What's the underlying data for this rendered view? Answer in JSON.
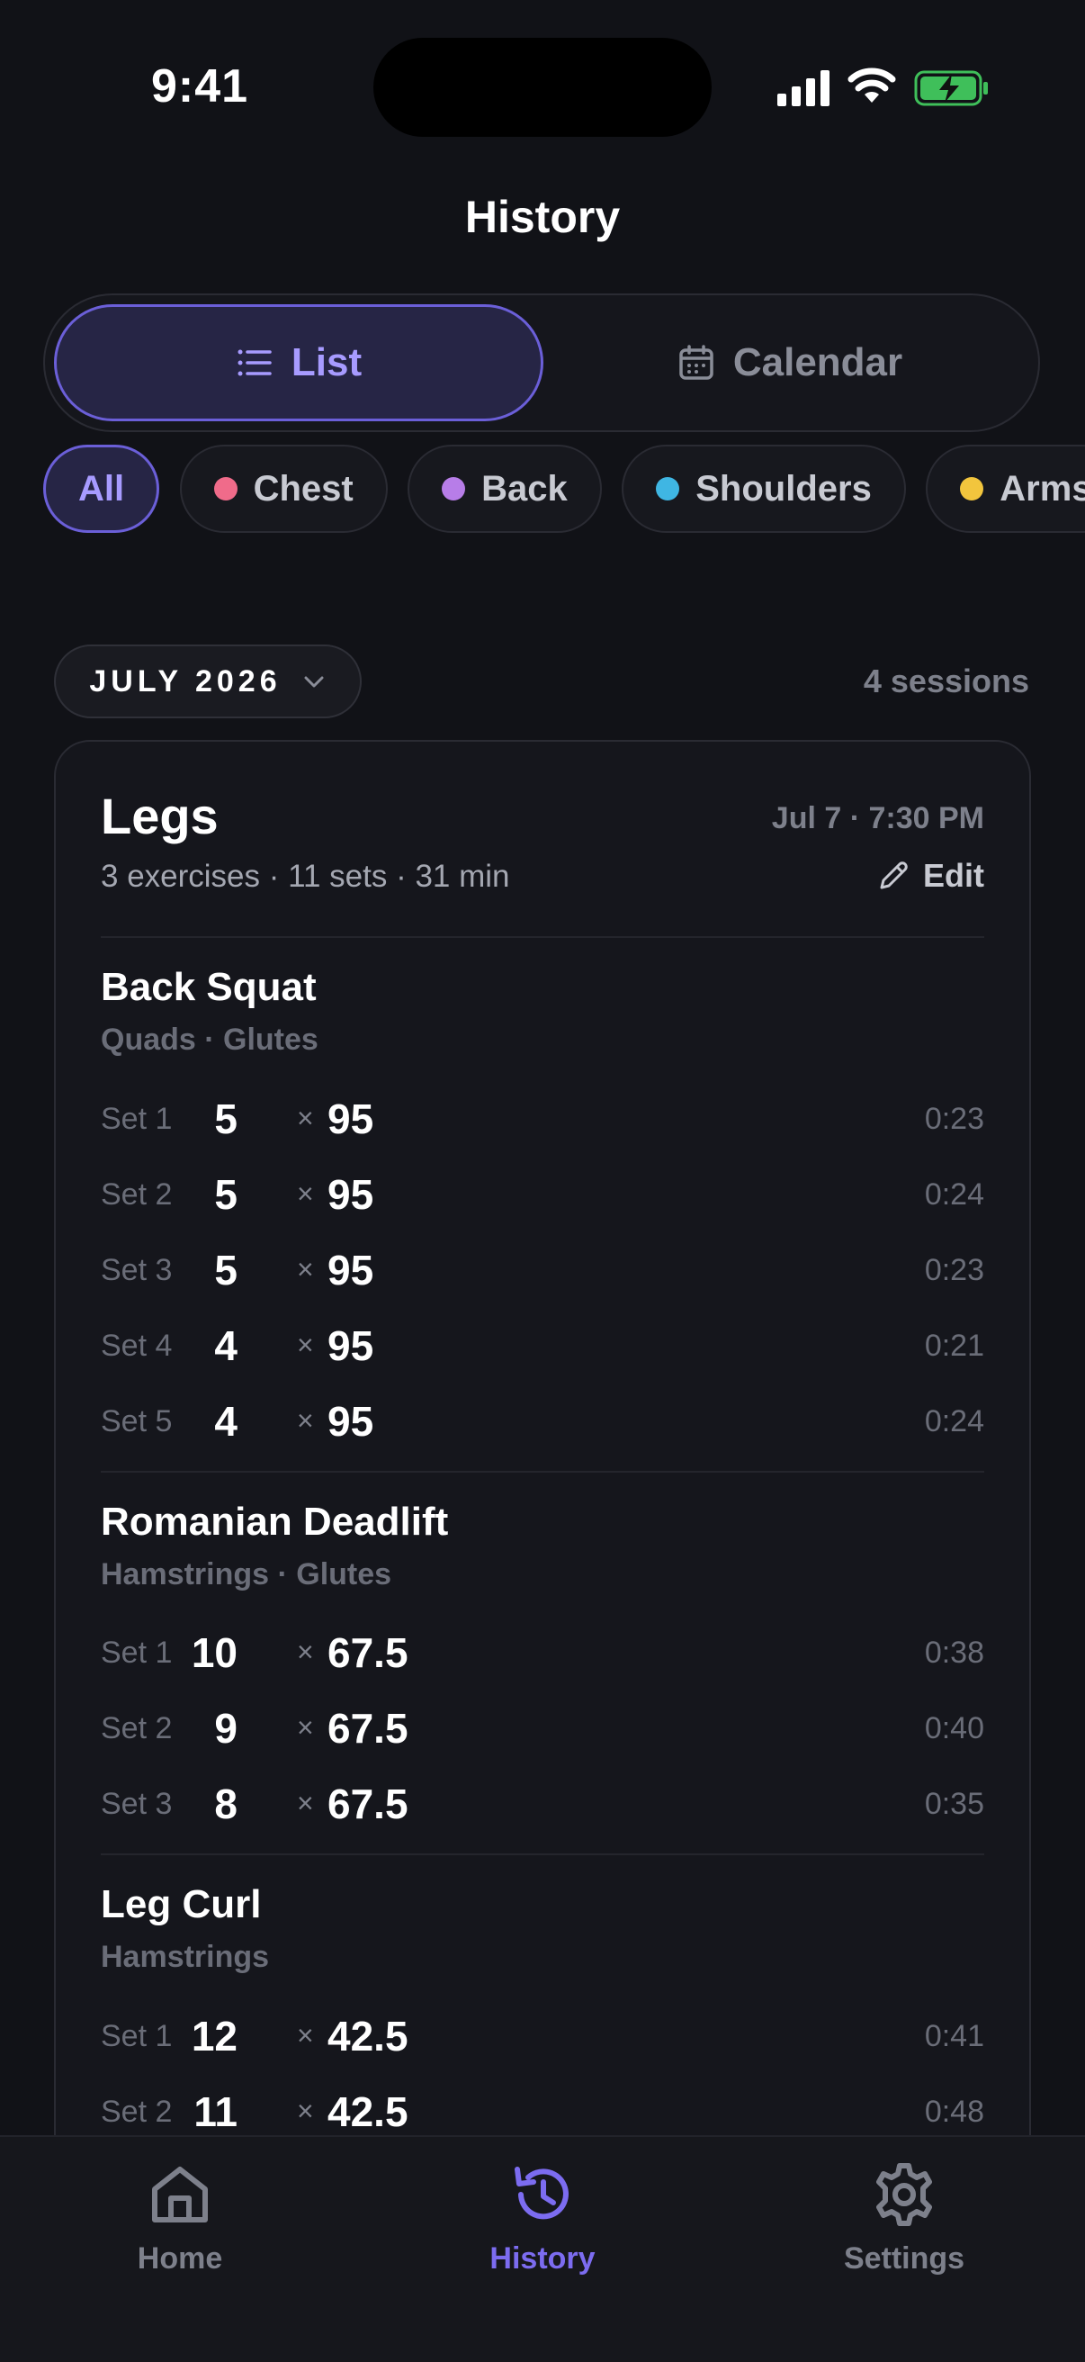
{
  "status_bar": {
    "time": "9:41"
  },
  "header": {
    "title": "History"
  },
  "view_toggle": {
    "list_label": "List",
    "calendar_label": "Calendar",
    "selected": "List"
  },
  "filters": [
    {
      "label": "All",
      "color": ""
    },
    {
      "label": "Chest",
      "color": "#f06b8a"
    },
    {
      "label": "Back",
      "color": "#b77de8"
    },
    {
      "label": "Shoulders",
      "color": "#3fb6e3"
    },
    {
      "label": "Arms",
      "color": "#f2c53d"
    }
  ],
  "month_selector": {
    "label": "JULY 2026",
    "session_count": "4 sessions"
  },
  "session": {
    "title": "Legs",
    "date": "Jul 7 · 7:30 PM",
    "summary": "3 exercises · 11 sets · 31 min",
    "edit_label": "Edit",
    "exercises": [
      {
        "name": "Back Squat",
        "muscles": "Quads · Glutes",
        "sets": [
          {
            "label": "Set 1",
            "reps": "5",
            "weight": "95",
            "time": "0:23"
          },
          {
            "label": "Set 2",
            "reps": "5",
            "weight": "95",
            "time": "0:24"
          },
          {
            "label": "Set 3",
            "reps": "5",
            "weight": "95",
            "time": "0:23"
          },
          {
            "label": "Set 4",
            "reps": "4",
            "weight": "95",
            "time": "0:21"
          },
          {
            "label": "Set 5",
            "reps": "4",
            "weight": "95",
            "time": "0:24"
          }
        ]
      },
      {
        "name": "Romanian Deadlift",
        "muscles": "Hamstrings · Glutes",
        "sets": [
          {
            "label": "Set 1",
            "reps": "10",
            "weight": "67.5",
            "time": "0:38"
          },
          {
            "label": "Set 2",
            "reps": "9",
            "weight": "67.5",
            "time": "0:40"
          },
          {
            "label": "Set 3",
            "reps": "8",
            "weight": "67.5",
            "time": "0:35"
          }
        ]
      },
      {
        "name": "Leg Curl",
        "muscles": "Hamstrings",
        "sets": [
          {
            "label": "Set 1",
            "reps": "12",
            "weight": "42.5",
            "time": "0:41"
          },
          {
            "label": "Set 2",
            "reps": "11",
            "weight": "42.5",
            "time": "0:48"
          }
        ]
      }
    ],
    "times_symbol": "×"
  },
  "tab_bar": {
    "home_label": "Home",
    "history_label": "History",
    "settings_label": "Settings",
    "active": "History"
  },
  "colors": {
    "accent": "#7c6cf0",
    "background": "#111217",
    "card": "#15161c"
  }
}
